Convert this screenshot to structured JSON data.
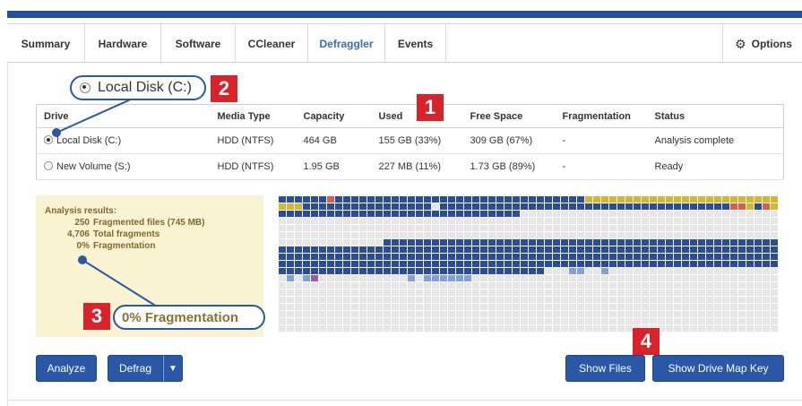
{
  "tabs": [
    {
      "label": "Summary"
    },
    {
      "label": "Hardware"
    },
    {
      "label": "Software"
    },
    {
      "label": "CCleaner"
    },
    {
      "label": "Defraggler"
    },
    {
      "label": "Events"
    }
  ],
  "options_label": "Options",
  "table": {
    "headers": [
      "Drive",
      "Media Type",
      "Capacity",
      "Used",
      "Free Space",
      "Fragmentation",
      "Status"
    ],
    "rows": [
      {
        "drive": "Local Disk (C:)",
        "media": "HDD (NTFS)",
        "capacity": "464 GB",
        "used": "155 GB (33%)",
        "free": "309 GB (67%)",
        "frag": "-",
        "status": "Analysis complete",
        "selected": true
      },
      {
        "drive": "New Volume (S:)",
        "media": "HDD (NTFS)",
        "capacity": "1.95 GB",
        "used": "227 MB (11%)",
        "free": "1.73 GB (89%)",
        "frag": "-",
        "status": "Ready",
        "selected": false
      }
    ]
  },
  "analysis": {
    "title": "Analysis results:",
    "rows": [
      {
        "value": "250",
        "label": "Fragmented files (745 MB)"
      },
      {
        "value": "4,706",
        "label": "Total fragments"
      },
      {
        "value": "0%",
        "label": "Fragmentation"
      }
    ]
  },
  "buttons": {
    "analyze": "Analyze",
    "defrag": "Defrag",
    "dropdown_arrow": "▼",
    "show_files": "Show Files",
    "show_drive_map_key": "Show Drive Map Key"
  },
  "callouts": {
    "one": "1",
    "two": "2",
    "three": "3",
    "four": "4",
    "drive_label": "Local Disk (C:)",
    "fragmentation_label": "0% Fragmentation"
  },
  "colors": {
    "accent": "#2a58a6",
    "used_block": "#2b4c9b",
    "fragmented_block": "#d6b62a",
    "error_block": "#e05a4a",
    "light_block": "#7fa0d8",
    "purple_block": "#9a5aa8",
    "free_block": "#e6e6e6",
    "callout_red": "#d9232a"
  },
  "icons": {
    "options": "gear-icon",
    "dropdown": "chevron-down-icon"
  }
}
